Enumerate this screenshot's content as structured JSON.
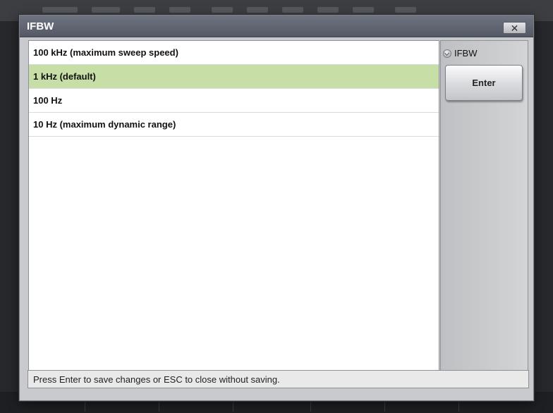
{
  "dialog": {
    "title": "IFBW",
    "close_glyph": "✕"
  },
  "list": {
    "items": [
      {
        "label": "100 kHz (maximum sweep speed)",
        "selected": false
      },
      {
        "label": "1 kHz (default)",
        "selected": true
      },
      {
        "label": "100 Hz",
        "selected": false
      },
      {
        "label": "10 Hz (maximum dynamic range)",
        "selected": false
      }
    ]
  },
  "side": {
    "ifbw_label": "IFBW",
    "enter_label": "Enter"
  },
  "status": {
    "message": "Press Enter to save changes or ESC to close without saving."
  },
  "colors": {
    "selected_row": "#c7dfa6",
    "titlebar": "#5f6370"
  },
  "icons": {
    "close": "close-icon",
    "ifbw": "chevron-down-icon"
  }
}
